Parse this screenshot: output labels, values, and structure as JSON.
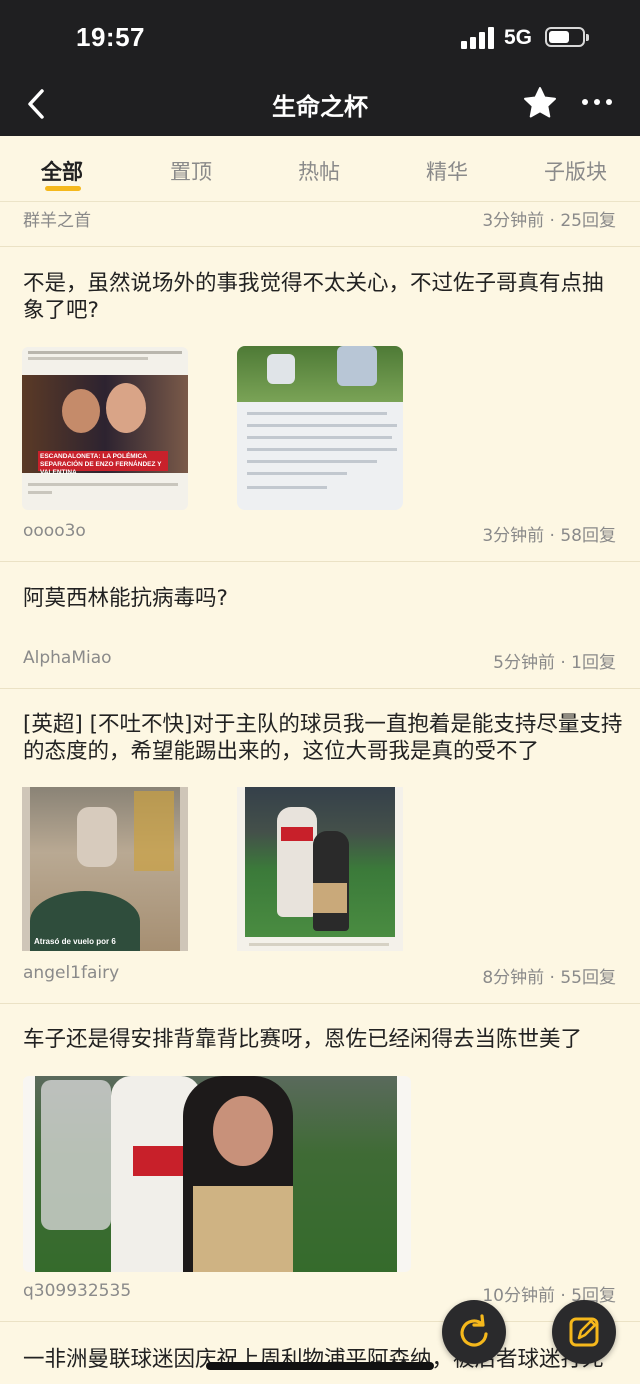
{
  "status": {
    "time": "19:57",
    "network": "5G"
  },
  "header": {
    "title": "生命之杯",
    "back_icon": "chevron-left-icon",
    "favorite_icon": "star-icon",
    "more_icon": "more-dots-icon"
  },
  "tabs": [
    {
      "label": "全部",
      "active": true
    },
    {
      "label": "置顶",
      "active": false
    },
    {
      "label": "热帖",
      "active": false
    },
    {
      "label": "精华",
      "active": false
    },
    {
      "label": "子版块",
      "active": false
    }
  ],
  "posts": [
    {
      "title": "",
      "author": "群羊之首",
      "meta": "3分钟前 · 25回复"
    },
    {
      "title": "不是，虽然说场外的事我觉得不太关心，不过佐子哥真有点抽象了吧?",
      "author": "oooo3o",
      "meta": "3分钟前 · 58回复",
      "image_caption": "ESCANDALONETA: LA POLÉMICA SEPARACIÓN DE ENZO FERNÁNDEZ Y VALENTINA"
    },
    {
      "title": "阿莫西林能抗病毒吗?",
      "author": "AlphaMiao",
      "meta": "5分钟前 · 1回复"
    },
    {
      "title": "[英超] [不吐不快]对于主队的球员我一直抱着是能支持尽量支持的态度的，希望能踢出来的，这位大哥我是真的受不了",
      "author": "angel1fairy",
      "meta": "8分钟前 · 55回复",
      "image_caption": "Atrasó de vuelo por 6"
    },
    {
      "title": "车子还是得安排背靠背比赛呀，恩佐已经闲得去当陈世美了",
      "author": "q309932535",
      "meta": "10分钟前 · 5回复"
    },
    {
      "title": "一非洲曼联球迷因庆祝上周利物浦平阿森纳，被后者球迷打死",
      "author": "",
      "meta": ""
    }
  ],
  "fabs": {
    "refresh_icon": "refresh-icon",
    "compose_icon": "compose-icon"
  },
  "colors": {
    "accent": "#f5b81c",
    "background": "#fdf7e3",
    "header": "#1f1f21"
  }
}
